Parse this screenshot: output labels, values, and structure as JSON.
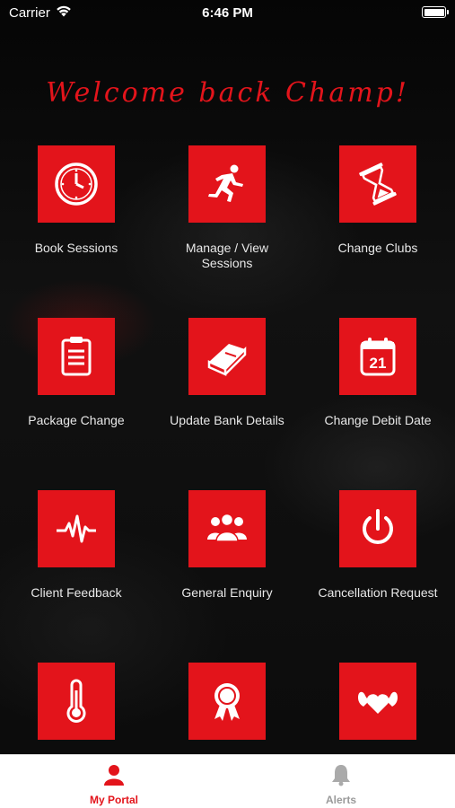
{
  "status_bar": {
    "carrier": "Carrier",
    "time": "6:46 PM"
  },
  "welcome": "Welcome back Champ!",
  "accent_color": "#e3141b",
  "tiles": [
    {
      "label": "Book Sessions",
      "icon": "clock-icon"
    },
    {
      "label": "Manage / View Sessions",
      "icon": "runner-icon"
    },
    {
      "label": "Change Clubs",
      "icon": "hourglass-icon"
    },
    {
      "label": "Package Change",
      "icon": "clipboard-icon"
    },
    {
      "label": "Update Bank Details",
      "icon": "book-icon"
    },
    {
      "label": "Change Debit Date",
      "icon": "calendar-icon",
      "icon_text": "21"
    },
    {
      "label": "Client Feedback",
      "icon": "heartbeat-icon"
    },
    {
      "label": "General Enquiry",
      "icon": "group-icon"
    },
    {
      "label": "Cancellation Request",
      "icon": "power-icon"
    },
    {
      "label": "",
      "icon": "thermometer-icon"
    },
    {
      "label": "",
      "icon": "award-ribbon-icon"
    },
    {
      "label": "",
      "icon": "heart-muscle-icon"
    }
  ],
  "tabbar": {
    "items": [
      {
        "label": "My Portal",
        "icon": "user-icon",
        "active": true
      },
      {
        "label": "Alerts",
        "icon": "bell-icon",
        "active": false
      }
    ]
  }
}
